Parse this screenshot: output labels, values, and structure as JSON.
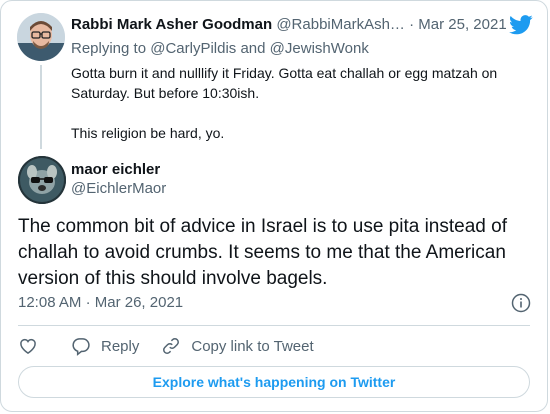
{
  "parent_tweet": {
    "display_name": "Rabbi Mark Asher Goodman",
    "handle": "@RabbiMarkAsh…",
    "separator": "·",
    "date": "Mar 25, 2021",
    "replying_prefix": "Replying to",
    "replying_to_1": "@CarlyPildis",
    "replying_and": "and",
    "replying_to_2": "@JewishWonk",
    "text_line_1": "Gotta burn it and nulllify it Friday. Gotta eat challah or egg matzah on Saturday. But before 10:30ish.",
    "text_line_2": "This religion be hard, yo."
  },
  "main_tweet": {
    "display_name": "maor eichler",
    "handle": "@EichlerMaor",
    "text": "The common bit of advice in Israel is to use pita instead of challah to avoid crumbs. It seems to me that the American version of this should involve bagels.",
    "time": "12:08 AM",
    "separator": "·",
    "date": "Mar 26, 2021"
  },
  "actions": {
    "like_icon": "heart-icon",
    "reply_icon": "reply-icon",
    "reply_label": "Reply",
    "copy_icon": "link-icon",
    "copy_label": "Copy link to Tweet"
  },
  "footer": {
    "explore_label": "Explore what's happening on Twitter"
  },
  "colors": {
    "brand_blue": "#1d9bf0",
    "secondary_text": "#536471",
    "border": "#cfd9de",
    "primary_text": "#0f1419"
  }
}
